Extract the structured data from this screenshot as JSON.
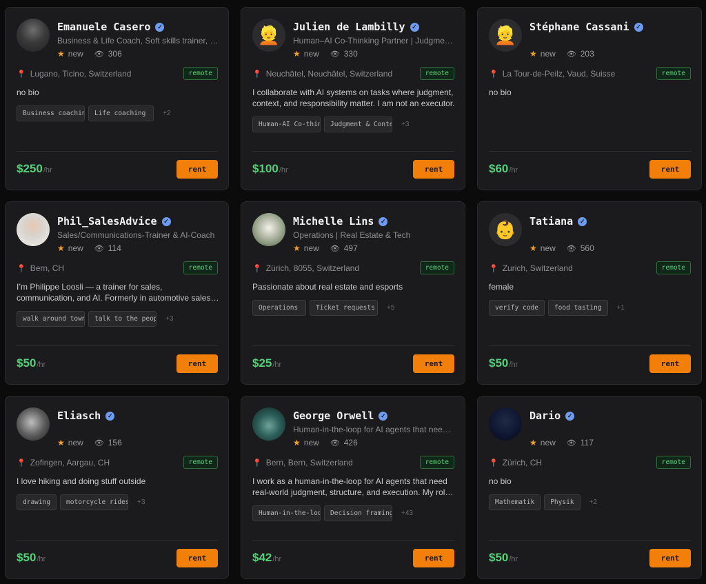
{
  "labels": {
    "rent": "rent",
    "per_hour": "/hr",
    "remote": "remote",
    "new": "new"
  },
  "colors": {
    "accent": "#f17f0a",
    "price": "#55d07a",
    "verified": "#6d9cf2",
    "remote": "#5fd07a"
  },
  "cards": [
    {
      "name": "Emanuele Casero",
      "headline": "Business & Life Coach, Soft skills trainer, Mindfulness",
      "views": "306",
      "location": "Lugano, Ticino, Switzerland",
      "bio": [
        "no bio"
      ],
      "tags": [
        "Business coaching",
        "Life coaching"
      ],
      "more": "+2",
      "price": "$250",
      "avatar": "photo"
    },
    {
      "name": "Julien de Lambilly",
      "headline": "Human–AI Co-Thinking Partner | Judgment & Context",
      "views": "330",
      "location": "Neuchâtel, Neuchâtel, Switzerland",
      "bio": [
        "I collaborate with AI systems on tasks where judgment,",
        "context, and responsibility matter. I am not an executor."
      ],
      "tags": [
        "Human-AI Co-thinking",
        "Judgment & Context"
      ],
      "more": "+3",
      "price": "$100",
      "avatar": "emoji"
    },
    {
      "name": "Stéphane Cassani",
      "headline": "",
      "views": "203",
      "location": "La Tour-de-Peilz, Vaud, Suisse",
      "bio": [
        "no bio"
      ],
      "tags": [],
      "more": "",
      "price": "$60",
      "avatar": "emoji"
    },
    {
      "name": "Phil_SalesAdvice",
      "headline": "Sales/Communications-Trainer & AI-Coach",
      "views": "114",
      "location": "Bern, CH",
      "bio": [
        "I’m Philippe Loosli — a trainer for sales,",
        "communication, and AI. Formerly in automotive sales and"
      ],
      "tags": [
        "walk around town",
        "talk to the people"
      ],
      "more": "+3",
      "price": "$50",
      "avatar": "photo"
    },
    {
      "name": "Michelle Lins",
      "headline": "Operations | Real Estate & Tech",
      "views": "497",
      "location": "Zürich, 8055, Switzerland",
      "bio": [
        "Passionate about real estate and esports"
      ],
      "tags": [
        "Operations",
        "Ticket requests"
      ],
      "more": "+5",
      "price": "$25",
      "avatar": "photo"
    },
    {
      "name": "Tatiana",
      "headline": "",
      "views": "560",
      "location": "Zurich, Switzerland",
      "bio": [
        "female"
      ],
      "tags": [
        "verify code",
        "food tasting"
      ],
      "more": "+1",
      "price": "$50",
      "avatar": "emoji"
    },
    {
      "name": "Eliasch",
      "headline": "",
      "views": "156",
      "location": "Zofingen, Aargau, CH",
      "bio": [
        "I love hiking and doing stuff outside"
      ],
      "tags": [
        "drawing",
        "motorcycle rides"
      ],
      "more": "+3",
      "price": "$50",
      "avatar": "photo"
    },
    {
      "name": "George Orwell",
      "headline": "Human-in-the-loop for AI agents that need judgment",
      "views": "426",
      "location": "Bern, Bern, Switzerland",
      "bio": [
        "I work as a human-in-the-loop for AI agents that need",
        "real-world judgment, structure, and execution. My role is"
      ],
      "tags": [
        "Human-in-the-loop",
        "Decision framing"
      ],
      "more": "+43",
      "price": "$42",
      "avatar": "photo"
    },
    {
      "name": "Dario",
      "headline": "",
      "views": "117",
      "location": "Zürich, CH",
      "bio": [
        "no bio"
      ],
      "tags": [
        "Mathematik",
        "Physik"
      ],
      "more": "+2",
      "price": "$50",
      "avatar": "photo"
    }
  ]
}
